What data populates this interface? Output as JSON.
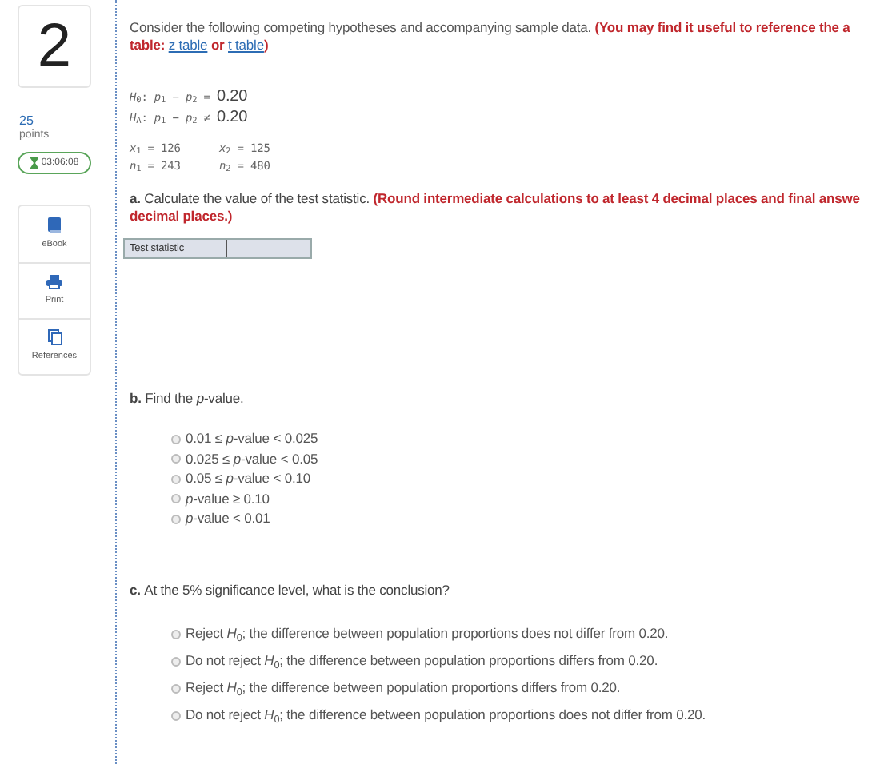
{
  "question_number": "2",
  "points": {
    "value": "25",
    "label": "points"
  },
  "timer": "03:06:08",
  "tools": [
    {
      "kind": "ebook",
      "label": "eBook"
    },
    {
      "kind": "print",
      "label": "Print"
    },
    {
      "kind": "references",
      "label": "References"
    }
  ],
  "intro": {
    "text": "Consider the following competing hypotheses and accompanying sample data.",
    "note": "(You may find it useful to reference the a",
    "note_line2": "table:",
    "links": [
      "z table",
      "t table"
    ],
    "joiner": "or",
    "close": ")"
  },
  "hypotheses": [
    {
      "label": "*H*$_{0}$: *p*$_{1}$ − *p*$_{2}$ =",
      "value": "0.20"
    },
    {
      "label": "*H*$_{A}$: *p*$_{1}$ − *p*$_{2}$ ≠",
      "value": "0.20"
    }
  ],
  "samples": [
    [
      "*x*$_{1}$ = 126",
      "*x*$_{2}$ = 125"
    ],
    [
      "*n*$_{1}$ = 243",
      "*n*$_{2}$ = 480"
    ]
  ],
  "part_a": {
    "label": "a.",
    "text": "Calculate the value of the test statistic.",
    "note": "(Round intermediate calculations to at least 4 decimal places and final answe",
    "note_line2": "decimal places.)",
    "field_label": "Test statistic"
  },
  "part_b": {
    "label": "b.",
    "text": "Find the *p*-value.",
    "options": [
      {
        "text": "0.01 ≤ *p*-value < 0.025",
        "selected": false
      },
      {
        "text": "0.025 ≤ *p*-value < 0.05",
        "selected": false
      },
      {
        "text": "0.05 ≤ *p*-value < 0.10",
        "selected": false
      },
      {
        "text": "*p*-value ≥ 0.10",
        "selected": false
      },
      {
        "text": "*p*-value < 0.01",
        "selected": false
      }
    ]
  },
  "part_c": {
    "label": "c.",
    "text": "At the 5% significance level, what is the conclusion?",
    "options": [
      {
        "text": "Reject *H*$_{0}$; the difference between population proportions does not differ from 0.20.",
        "selected": false
      },
      {
        "text": "Do not reject *H*$_{0}$; the difference between population proportions differs from 0.20.",
        "selected": false
      },
      {
        "text": "Reject *H*$_{0}$; the difference between population proportions differs from 0.20.",
        "selected": false
      },
      {
        "text": "Do not reject *H*$_{0}$; the difference between population proportions does not differ from 0.20.",
        "selected": false
      }
    ]
  }
}
